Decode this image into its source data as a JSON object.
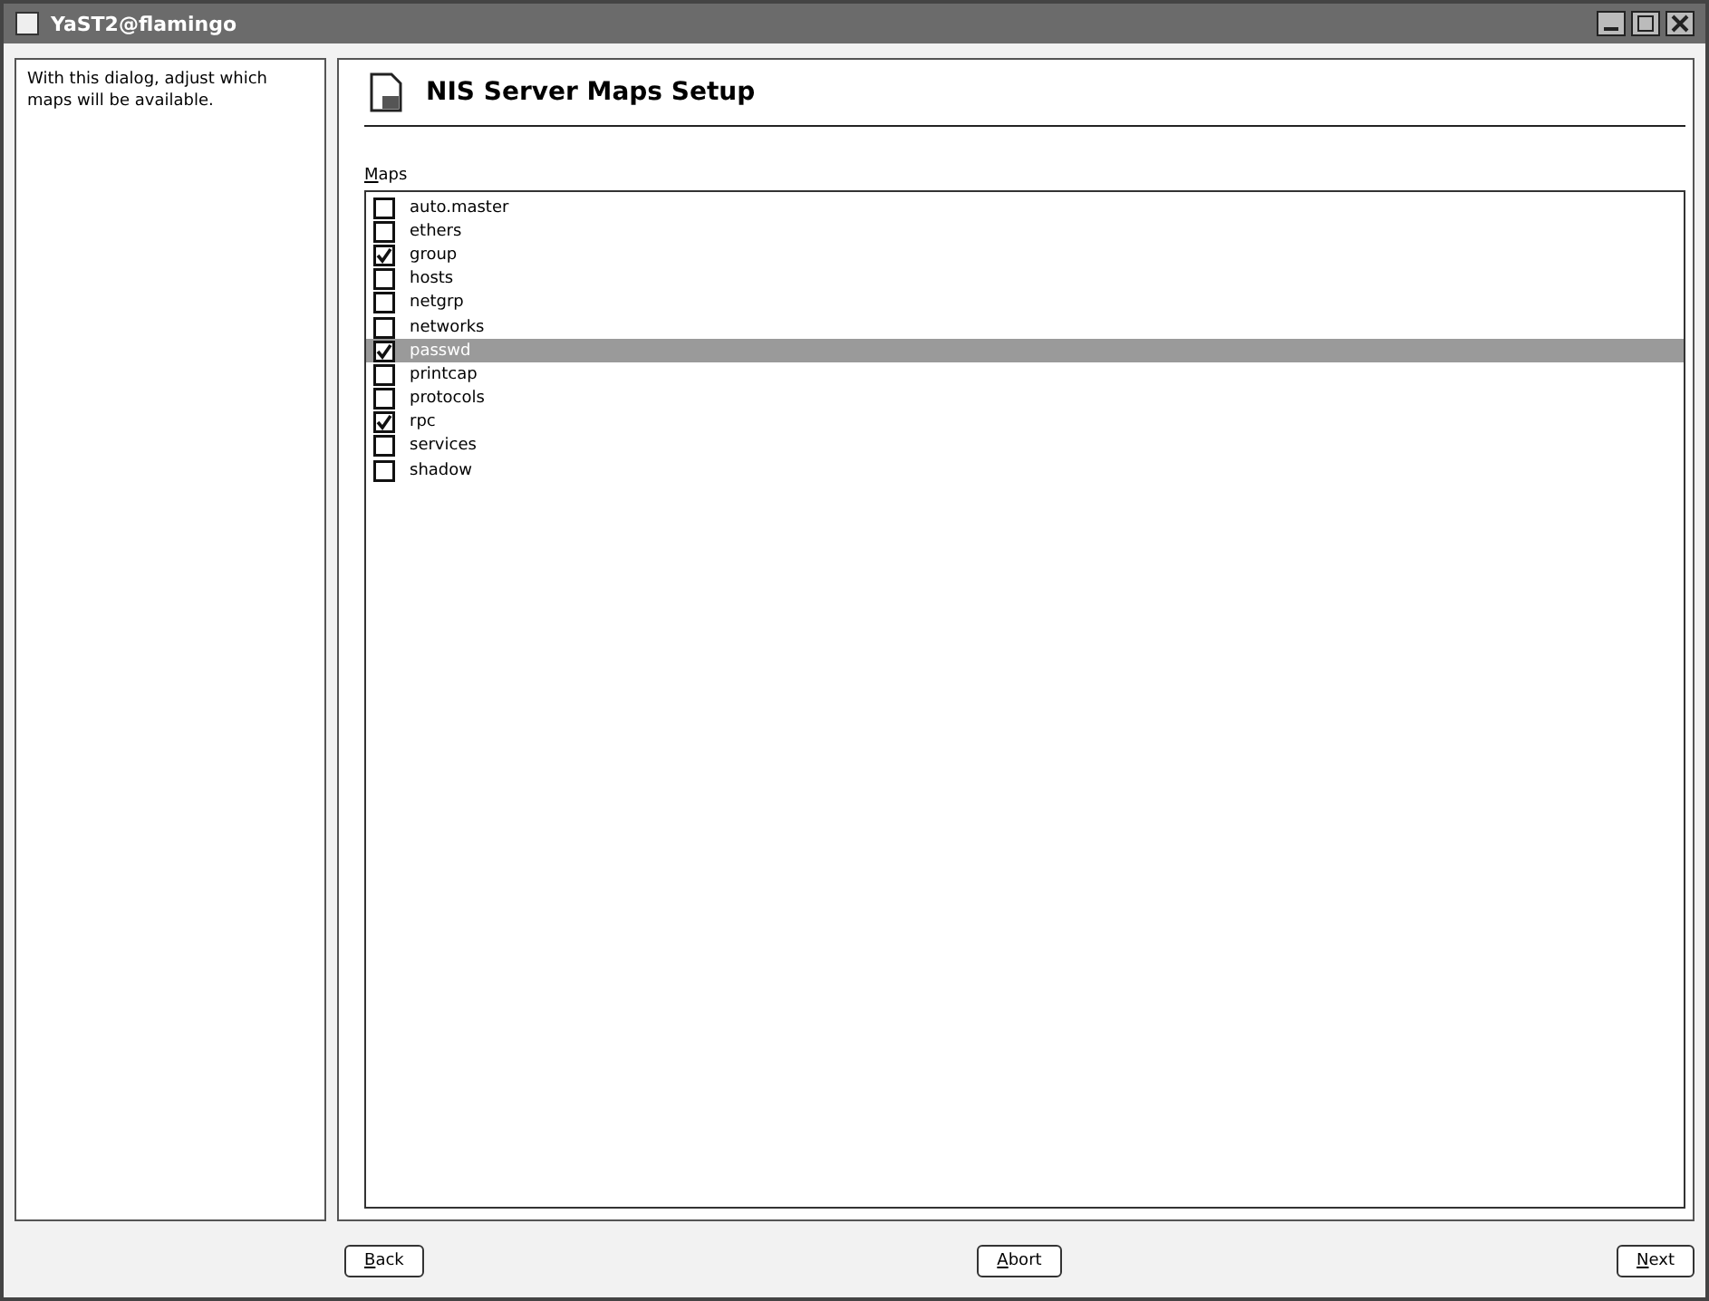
{
  "window": {
    "title": "YaST2@flamingo"
  },
  "help_text": "With this dialog, adjust which maps will be available.",
  "header": {
    "title": "NIS Server Maps Setup"
  },
  "maps": {
    "label": "Maps",
    "items": [
      {
        "name": "auto.master",
        "checked": false,
        "selected": false
      },
      {
        "name": "ethers",
        "checked": false,
        "selected": false
      },
      {
        "name": "group",
        "checked": true,
        "selected": false
      },
      {
        "name": "hosts",
        "checked": false,
        "selected": false
      },
      {
        "name": "netgrp",
        "checked": false,
        "selected": false
      },
      {
        "name": "networks",
        "checked": false,
        "selected": false
      },
      {
        "name": "passwd",
        "checked": true,
        "selected": true
      },
      {
        "name": "printcap",
        "checked": false,
        "selected": false
      },
      {
        "name": "protocols",
        "checked": false,
        "selected": false
      },
      {
        "name": "rpc",
        "checked": true,
        "selected": false
      },
      {
        "name": "services",
        "checked": false,
        "selected": false
      },
      {
        "name": "shadow",
        "checked": false,
        "selected": false
      }
    ]
  },
  "buttons": [
    {
      "label": "Back",
      "kind": "back"
    },
    {
      "label": "Abort",
      "kind": "abort"
    },
    {
      "label": "Next",
      "kind": "next"
    }
  ]
}
